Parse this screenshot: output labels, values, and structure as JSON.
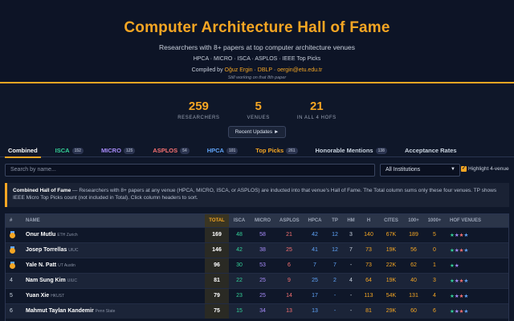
{
  "header": {
    "title": "Computer Architecture Hall of Fame",
    "subtitle": "Researchers with 8+ papers at top computer architecture venues",
    "venues_line": "HPCA · MICRO · ISCA · ASPLOS · IEEE Top Picks",
    "compiled_prefix": "Compiled by ",
    "compiled_author": "Oğuz Ergin",
    "compiled_sep": " · ",
    "compiled_dblp": "DBLP",
    "compiled_email": "oergin@etu.edu.tr",
    "note": "Still working on that 8th paper"
  },
  "stats": [
    {
      "value": "259",
      "label": "RESEARCHERS"
    },
    {
      "value": "5",
      "label": "VENUES"
    },
    {
      "value": "21",
      "label": "IN ALL 4 HOFS"
    }
  ],
  "recent_button": "Recent Updates ►",
  "tabs": [
    {
      "label": "Combined",
      "badge": "",
      "color": "#ffffff"
    },
    {
      "label": "ISCA",
      "badge": "152",
      "color": "#34d399"
    },
    {
      "label": "MICRO",
      "badge": "125",
      "color": "#a78bfa"
    },
    {
      "label": "ASPLOS",
      "badge": "54",
      "color": "#f87171"
    },
    {
      "label": "HPCA",
      "badge": "101",
      "color": "#60a5fa"
    },
    {
      "label": "Top Picks",
      "badge": "261",
      "color": "#f5a623"
    },
    {
      "label": "Honorable Mentions",
      "badge": "138",
      "color": "#cbd5e1"
    },
    {
      "label": "Acceptance Rates",
      "badge": "",
      "color": "#cbd5e1"
    }
  ],
  "search": {
    "placeholder": "Search by name..."
  },
  "filter": {
    "selected": "All Institutions"
  },
  "highlight_label": "Highlight 4-venue",
  "info": {
    "title": "Combined Hall of Fame",
    "text": " — Researchers with 8+ papers at any venue (HPCA, MICRO, ISCA, or ASPLOS) are inducted into that venue's Hall of Fame. The Total column sums only these four venues. TP shows IEEE Micro Top Picks count (not included in Total). Click column headers to sort."
  },
  "table": {
    "columns": [
      "#",
      "NAME",
      "TOTAL",
      "ISCA",
      "MICRO",
      "ASPLOS",
      "HPCA",
      "TP",
      "HM",
      "H",
      "CITES",
      "100+",
      "1000+",
      "HOF VENUES"
    ],
    "rows": [
      {
        "rank": "",
        "medal": true,
        "name": "Onur Mutlu",
        "aff": "ETH Zurich",
        "total": "169",
        "isca": "48",
        "micro": "58",
        "asplos": "21",
        "hpca": "42",
        "tp": "12",
        "hm": "3",
        "h": "140",
        "cites": "67K",
        "c100": "189",
        "c1000": "5",
        "hof": [
          "isca",
          "micro",
          "asplos",
          "hpca"
        ]
      },
      {
        "rank": "",
        "medal": true,
        "name": "Josep Torrellas",
        "aff": "UIUC",
        "total": "146",
        "isca": "42",
        "micro": "38",
        "asplos": "25",
        "hpca": "41",
        "tp": "12",
        "hm": "7",
        "h": "73",
        "cites": "19K",
        "c100": "56",
        "c1000": "0",
        "hof": [
          "isca",
          "micro",
          "asplos",
          "hpca"
        ]
      },
      {
        "rank": "",
        "medal": true,
        "name": "Yale N. Patt",
        "aff": "UT Austin",
        "total": "96",
        "isca": "30",
        "micro": "53",
        "asplos": "6",
        "hpca": "7",
        "tp": "7",
        "hm": "-",
        "h": "73",
        "cites": "22K",
        "c100": "62",
        "c1000": "1",
        "hof": [
          "isca",
          "micro"
        ]
      },
      {
        "rank": "4",
        "medal": false,
        "name": "Nam Sung Kim",
        "aff": "UIUC",
        "total": "81",
        "isca": "22",
        "micro": "25",
        "asplos": "9",
        "hpca": "25",
        "tp": "2",
        "hm": "4",
        "h": "64",
        "cites": "19K",
        "c100": "40",
        "c1000": "3",
        "hof": [
          "isca",
          "micro",
          "asplos",
          "hpca"
        ]
      },
      {
        "rank": "5",
        "medal": false,
        "name": "Yuan Xie",
        "aff": "HKUST",
        "total": "79",
        "isca": "23",
        "micro": "25",
        "asplos": "14",
        "hpca": "17",
        "tp": "-",
        "hm": "-",
        "h": "113",
        "cites": "54K",
        "c100": "131",
        "c1000": "4",
        "hof": [
          "isca",
          "micro",
          "asplos",
          "hpca"
        ]
      },
      {
        "rank": "6",
        "medal": false,
        "name": "Mahmut Taylan Kandemir",
        "aff": "Penn State",
        "total": "75",
        "isca": "15",
        "micro": "34",
        "asplos": "13",
        "hpca": "13",
        "tp": "-",
        "hm": "-",
        "h": "81",
        "cites": "29K",
        "c100": "60",
        "c1000": "6",
        "hof": [
          "isca",
          "micro",
          "asplos",
          "hpca"
        ]
      }
    ]
  }
}
